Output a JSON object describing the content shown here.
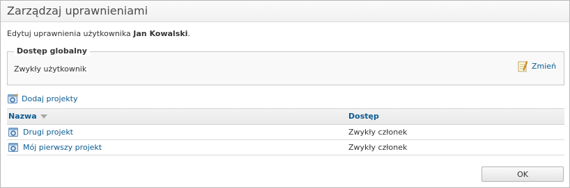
{
  "dialog": {
    "title": "Zarządzaj uprawnieniami",
    "intro_prefix": "Edytuj uprawnienia użytkownika ",
    "user_name": "Jan Kowalski",
    "intro_suffix": "."
  },
  "global_access": {
    "legend": "Dostęp globalny",
    "value": "Zwykły użytkownik",
    "change_label": "Zmień",
    "change_icon": "edit-note-icon"
  },
  "add_projects": {
    "label": "Dodaj projekty",
    "icon": "add-project-icon"
  },
  "table": {
    "columns": {
      "name": "Nazwa",
      "access": "Dostęp"
    },
    "sort_icon": "sort-descending-icon",
    "rows": [
      {
        "name": "Drugi projekt",
        "access": "Zwykły członek",
        "icon": "project-icon"
      },
      {
        "name": "Mój pierwszy projekt",
        "access": "Zwykły członek",
        "icon": "project-icon"
      }
    ]
  },
  "footer": {
    "ok_label": "OK"
  },
  "colors": {
    "link": "#0b5b92",
    "text": "#333333",
    "border": "#c7c7c7"
  }
}
